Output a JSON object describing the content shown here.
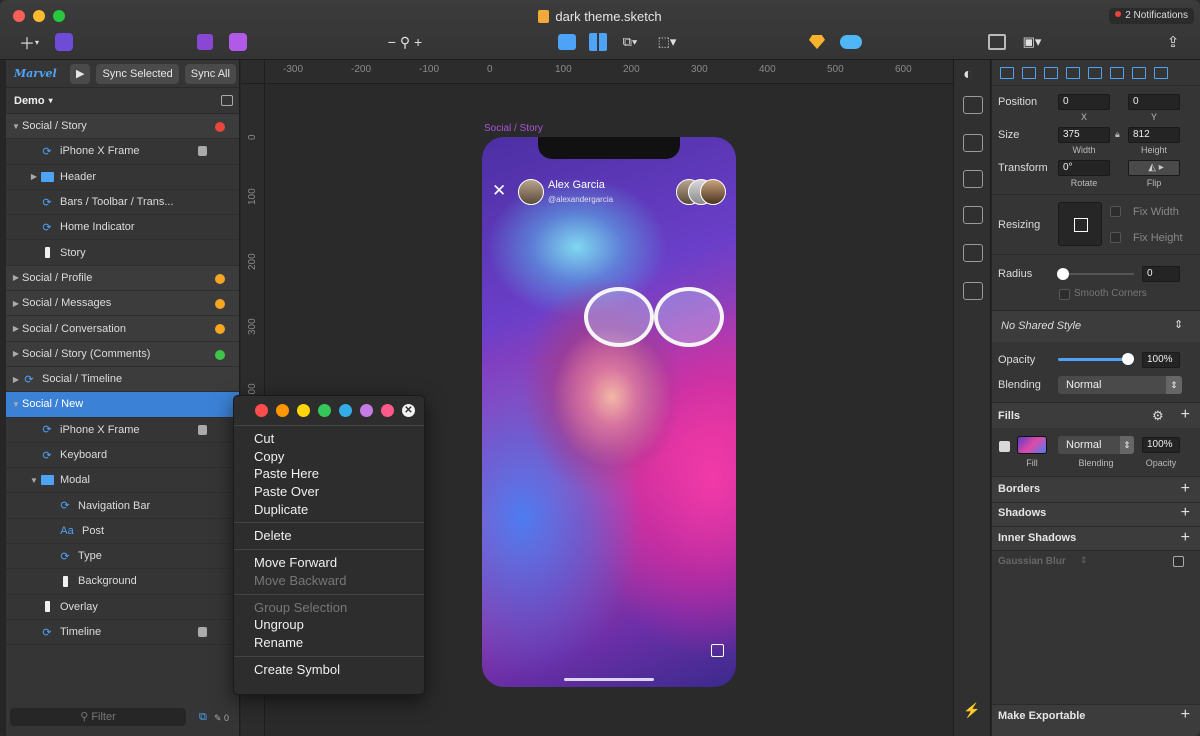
{
  "window": {
    "title": "dark theme.sketch",
    "notifications": "2 Notifications"
  },
  "marvel": {
    "logo": "Marvel",
    "sync_selected": "Sync Selected",
    "sync_all": "Sync All"
  },
  "page": {
    "name": "Demo"
  },
  "layers": [
    {
      "label": "Social / Story",
      "type": "artboard",
      "status": "#e8453c"
    },
    {
      "label": "iPhone X Frame",
      "type": "symbol",
      "locked": true
    },
    {
      "label": "Header",
      "type": "folder"
    },
    {
      "label": "Bars / Toolbar / Trans...",
      "type": "symbol"
    },
    {
      "label": "Home Indicator",
      "type": "symbol"
    },
    {
      "label": "Story",
      "type": "rect"
    },
    {
      "label": "Social / Profile",
      "type": "artboard",
      "status": "#f5a623"
    },
    {
      "label": "Social / Messages",
      "type": "artboard",
      "status": "#f5a623"
    },
    {
      "label": "Social / Conversation",
      "type": "artboard",
      "status": "#f5a623"
    },
    {
      "label": "Social / Story (Comments)",
      "type": "artboard",
      "status": "#3ec44a"
    },
    {
      "label": "Social / Timeline",
      "type": "artboard-symbol"
    },
    {
      "label": "Social / New",
      "type": "artboard",
      "selected": true
    },
    {
      "label": "iPhone X Frame",
      "type": "symbol",
      "locked": true
    },
    {
      "label": "Keyboard",
      "type": "symbol"
    },
    {
      "label": "Modal",
      "type": "folder"
    },
    {
      "label": "Navigation Bar",
      "type": "symbol"
    },
    {
      "label": "Post",
      "type": "text"
    },
    {
      "label": "Type",
      "type": "symbol"
    },
    {
      "label": "Background",
      "type": "rect"
    },
    {
      "label": "Overlay",
      "type": "rect"
    },
    {
      "label": "Timeline",
      "type": "symbol",
      "locked": true
    }
  ],
  "filter": {
    "placeholder": "Filter",
    "count": "0"
  },
  "canvas": {
    "ruler_h": [
      "-300",
      "-200",
      "-100",
      "0",
      "100",
      "200",
      "300",
      "400",
      "500",
      "600"
    ],
    "ruler_v": [
      "0",
      "100",
      "200",
      "300",
      "400"
    ],
    "artboard_label": "Social / Story",
    "story": {
      "name": "Alex Garcia",
      "handle": "@alexandergarcia"
    }
  },
  "context_menu": {
    "colors": [
      "#ff4d4d",
      "#ff9500",
      "#ffd60a",
      "#34c759",
      "#32ade6",
      "#c57be3",
      "#ff5a8c"
    ],
    "groups": [
      [
        {
          "label": "Cut"
        },
        {
          "label": "Copy"
        },
        {
          "label": "Paste Here"
        },
        {
          "label": "Paste Over"
        },
        {
          "label": "Duplicate"
        }
      ],
      [
        {
          "label": "Delete"
        }
      ],
      [
        {
          "label": "Move Forward"
        },
        {
          "label": "Move Backward",
          "disabled": true
        }
      ],
      [
        {
          "label": "Group Selection",
          "disabled": true
        },
        {
          "label": "Ungroup"
        },
        {
          "label": "Rename"
        }
      ],
      [
        {
          "label": "Create Symbol"
        }
      ]
    ]
  },
  "inspector": {
    "position": {
      "label": "Position",
      "x": "0",
      "y": "0",
      "x_label": "X",
      "y_label": "Y"
    },
    "size": {
      "label": "Size",
      "width": "375",
      "height": "812",
      "w_label": "Width",
      "h_label": "Height"
    },
    "transform": {
      "label": "Transform",
      "rotate": "0°",
      "rotate_label": "Rotate",
      "flip_label": "Flip"
    },
    "resizing": {
      "label": "Resizing",
      "fix_width": "Fix Width",
      "fix_height": "Fix Height"
    },
    "radius": {
      "label": "Radius",
      "value": "0",
      "smooth": "Smooth Corners"
    },
    "shared_style": "No Shared Style",
    "opacity": {
      "label": "Opacity",
      "value": "100%"
    },
    "blending": {
      "label": "Blending",
      "value": "Normal"
    },
    "fills": {
      "title": "Fills",
      "blend": "Normal",
      "opacity": "100%",
      "fill_label": "Fill",
      "blend_label": "Blending",
      "opacity_label": "Opacity"
    },
    "borders": "Borders",
    "shadows": "Shadows",
    "inner_shadows": "Inner Shadows",
    "gaussian_blur": "Gaussian Blur",
    "make_exportable": "Make Exportable"
  },
  "accent": "#3b82d6"
}
